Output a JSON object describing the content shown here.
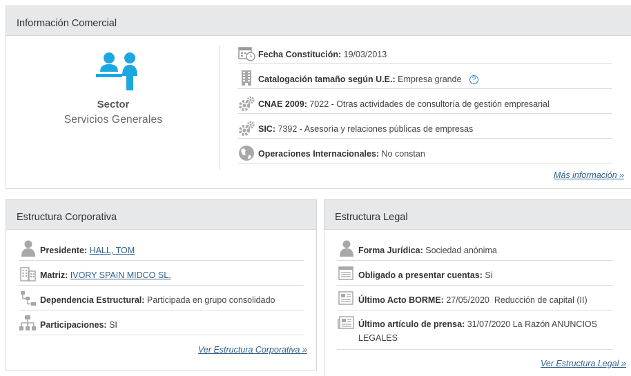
{
  "comercial": {
    "title": "Información Comercial",
    "sector_label": "Sector",
    "sector_value": "Servicios Generales",
    "rows": [
      {
        "label": "Fecha Constitución:",
        "value": "19/03/2013",
        "icon": "calendar-clock-icon"
      },
      {
        "label": "Catalogación tamaño según U.E.:",
        "value": "Empresa grande",
        "icon": "building-icon",
        "help": "?"
      },
      {
        "label": "CNAE 2009:",
        "value": "7022 - Otras actividades de consultoría de gestión empresarial",
        "icon": "gears-icon"
      },
      {
        "label": "SIC:",
        "value": "7392 - Asesoría y relaciones públicas de empresas",
        "icon": "gears-icon"
      },
      {
        "label": "Operaciones Internacionales:",
        "value": "No constan",
        "icon": "globe-icon"
      }
    ],
    "more_link": "Más información »"
  },
  "corporativa": {
    "title": "Estructura Corporativa",
    "rows": [
      {
        "label": "Presidente:",
        "value": "HALL, TOM",
        "icon": "person-icon",
        "link": true
      },
      {
        "label": "Matriz:",
        "value": "IVORY SPAIN MIDCO SL.",
        "icon": "buildings-icon",
        "link": true
      },
      {
        "label": "Dependencia Estructural:",
        "value": "Participada en grupo consolidado",
        "icon": "hierarchy-icon"
      },
      {
        "label": "Participaciones:",
        "value": "SI",
        "icon": "org-chart-icon"
      }
    ],
    "more_link": "Ver Estructura Corporativa »"
  },
  "legal": {
    "title": "Estructura Legal",
    "rows": [
      {
        "label": "Forma Jurídica:",
        "value": "Sociedad anónima",
        "icon": "person-icon"
      },
      {
        "label": "Obligado a presentar cuentas:",
        "value": "Si",
        "icon": "ledger-icon"
      },
      {
        "label": "Último Acto BORME:",
        "value": "27/05/2020  Reducción de capital (II)",
        "icon": "gazette-icon"
      },
      {
        "label": "Último artículo de prensa:",
        "value": "31/07/2020 La Razón ANUNCIOS",
        "value_line2": "LEGALES",
        "icon": "newspaper-icon"
      }
    ],
    "more_link": "Ver Estructura Legal »"
  },
  "colors": {
    "accent": "#1ba8e0",
    "link": "#2f5f8a",
    "icon_gray": "#9a9a9a"
  }
}
